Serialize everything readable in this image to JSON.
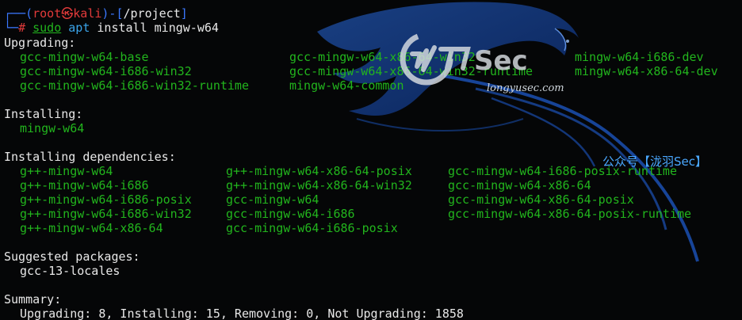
{
  "prompt": {
    "user": "root",
    "skull": "㉿",
    "host": "kali",
    "path": "/project",
    "hash": "#",
    "cmd_sudo": "sudo",
    "cmd_apt": "apt",
    "cmd_rest": "install mingw-w64"
  },
  "upgrading": {
    "heading": "Upgrading:",
    "rows": [
      [
        "gcc-mingw-w64-base",
        "gcc-mingw-w64-x86-64-win32",
        "mingw-w64-i686-dev"
      ],
      [
        "gcc-mingw-w64-i686-win32",
        "gcc-mingw-w64-x86-64-win32-runtime",
        "mingw-w64-x86-64-dev"
      ],
      [
        "gcc-mingw-w64-i686-win32-runtime",
        "mingw-w64-common",
        ""
      ]
    ]
  },
  "installing": {
    "heading": "Installing:",
    "rows": [
      [
        "mingw-w64"
      ]
    ]
  },
  "dependencies": {
    "heading": "Installing dependencies:",
    "rows": [
      [
        "g++-mingw-w64",
        "g++-mingw-w64-x86-64-posix",
        "gcc-mingw-w64-i686-posix-runtime"
      ],
      [
        "g++-mingw-w64-i686",
        "g++-mingw-w64-x86-64-win32",
        "gcc-mingw-w64-x86-64"
      ],
      [
        "g++-mingw-w64-i686-posix",
        "gcc-mingw-w64",
        "gcc-mingw-w64-x86-64-posix"
      ],
      [
        "g++-mingw-w64-i686-win32",
        "gcc-mingw-w64-i686",
        "gcc-mingw-w64-x86-64-posix-runtime"
      ],
      [
        "g++-mingw-w64-x86-64",
        "gcc-mingw-w64-i686-posix",
        ""
      ]
    ]
  },
  "suggested": {
    "heading": "Suggested packages:",
    "rows": [
      [
        "gcc-13-locales"
      ]
    ]
  },
  "summary": {
    "heading": "Summary:",
    "line": "Upgrading: 8, Installing: 15, Removing: 0, Not Upgrading: 1858"
  },
  "watermark": {
    "logo_text": "Sec",
    "domain": "longyusec.com",
    "wechat": "公众号【泷羽Sec】"
  },
  "colors": {
    "background": "#050607",
    "package_green": "#22b51d",
    "prompt_blue": "#3b78ff",
    "prompt_red": "#e23a3a",
    "dragon_blue": "#1f5fd6"
  }
}
